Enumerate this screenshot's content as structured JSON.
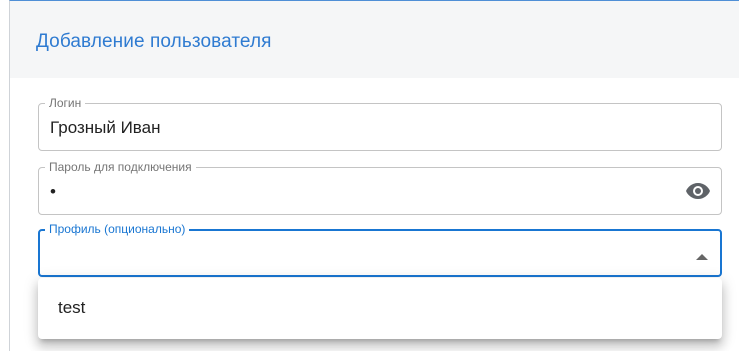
{
  "dialog": {
    "title": "Добавление пользователя"
  },
  "form": {
    "login": {
      "label": "Логин",
      "value": "Грозный Иван"
    },
    "password": {
      "label": "Пароль для подключения",
      "value": "•",
      "visibility_icon": "eye-icon"
    },
    "profile": {
      "label": "Профиль (опционально)",
      "value": "",
      "toggle_icon": "caret-up-icon"
    }
  },
  "dropdown": {
    "options": [
      "test"
    ]
  },
  "colors": {
    "accent": "#1976d2",
    "title": "#2f7bd1",
    "header_bg": "#f5f6f7",
    "field_border": "#c4c4c4"
  }
}
